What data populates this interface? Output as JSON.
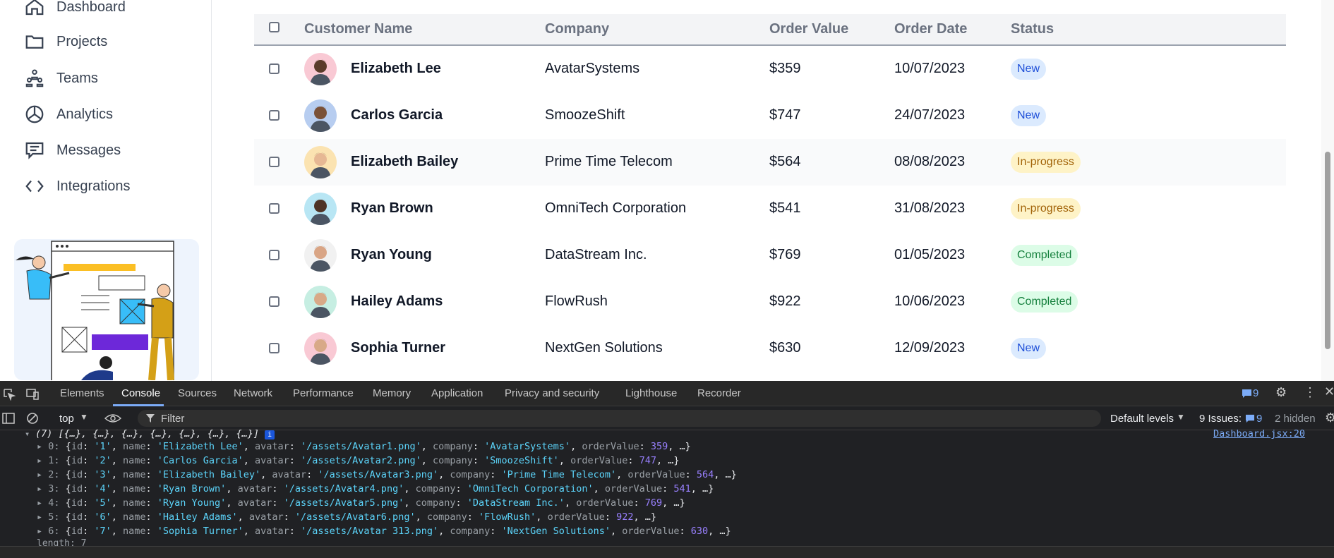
{
  "sidebar": {
    "items": [
      {
        "label": "Dashboard",
        "icon": "home-icon"
      },
      {
        "label": "Projects",
        "icon": "folder-icon"
      },
      {
        "label": "Teams",
        "icon": "teams-icon"
      },
      {
        "label": "Analytics",
        "icon": "pie-chart-icon"
      },
      {
        "label": "Messages",
        "icon": "message-icon"
      },
      {
        "label": "Integrations",
        "icon": "code-icon"
      }
    ]
  },
  "table": {
    "headers": {
      "customer": "Customer Name",
      "company": "Company",
      "order_value": "Order Value",
      "order_date": "Order Date",
      "status": "Status"
    },
    "rows": [
      {
        "name": "Elizabeth Lee",
        "company": "AvatarSystems",
        "value": "$359",
        "date": "10/07/2023",
        "status": "New",
        "status_kind": "new",
        "avatar_bg": "#f9c9d4",
        "skin": "#5a3b2a"
      },
      {
        "name": "Carlos Garcia",
        "company": "SmoozeShift",
        "value": "$747",
        "date": "24/07/2023",
        "status": "New",
        "status_kind": "new",
        "avatar_bg": "#b7cdf0",
        "skin": "#7a5138"
      },
      {
        "name": "Elizabeth Bailey",
        "company": "Prime Time Telecom",
        "value": "$564",
        "date": "08/08/2023",
        "status": "In-progress",
        "status_kind": "inprogress",
        "avatar_bg": "#fbe3b1",
        "skin": "#e6b894"
      },
      {
        "name": "Ryan Brown",
        "company": "OmniTech Corporation",
        "value": "$541",
        "date": "31/08/2023",
        "status": "In-progress",
        "status_kind": "inprogress",
        "avatar_bg": "#b8e6f4",
        "skin": "#4e3325"
      },
      {
        "name": "Ryan Young",
        "company": "DataStream Inc.",
        "value": "$769",
        "date": "01/05/2023",
        "status": "Completed",
        "status_kind": "completed",
        "avatar_bg": "#f1f1f1",
        "skin": "#d9a585"
      },
      {
        "name": "Hailey Adams",
        "company": "FlowRush",
        "value": "$922",
        "date": "10/06/2023",
        "status": "Completed",
        "status_kind": "completed",
        "avatar_bg": "#c6eee2",
        "skin": "#d8a987"
      },
      {
        "name": "Sophia Turner",
        "company": "NextGen Solutions",
        "value": "$630",
        "date": "12/09/2023",
        "status": "New",
        "status_kind": "new",
        "avatar_bg": "#f9c9d4",
        "skin": "#d8a987"
      }
    ]
  },
  "devtools": {
    "tabs": [
      "Elements",
      "Console",
      "Sources",
      "Network",
      "Performance",
      "Memory",
      "Application",
      "Privacy and security",
      "Lighthouse",
      "Recorder"
    ],
    "active_tab": "Console",
    "message_count": "9",
    "context": "top",
    "filter_placeholder": "Filter",
    "levels": "Default levels",
    "issues_label": "9 Issues:",
    "issues_count": "9",
    "hidden": "2 hidden",
    "source_link": "Dashboard.jsx:20",
    "array_summary": "(7) [{…}, {…}, {…}, {…}, {…}, {…}, {…}]",
    "entries": [
      {
        "idx": "0",
        "id": "'1'",
        "name": "'Elizabeth Lee'",
        "avatar": "'/assets/Avatar1.png'",
        "company": "'AvatarSystems'",
        "orderValue": "359"
      },
      {
        "idx": "1",
        "id": "'2'",
        "name": "'Carlos Garcia'",
        "avatar": "'/assets/Avatar2.png'",
        "company": "'SmoozeShift'",
        "orderValue": "747"
      },
      {
        "idx": "2",
        "id": "'3'",
        "name": "'Elizabeth Bailey'",
        "avatar": "'/assets/Avatar3.png'",
        "company": "'Prime Time Telecom'",
        "orderValue": "564"
      },
      {
        "idx": "3",
        "id": "'4'",
        "name": "'Ryan Brown'",
        "avatar": "'/assets/Avatar4.png'",
        "company": "'OmniTech Corporation'",
        "orderValue": "541"
      },
      {
        "idx": "4",
        "id": "'5'",
        "name": "'Ryan Young'",
        "avatar": "'/assets/Avatar5.png'",
        "company": "'DataStream Inc.'",
        "orderValue": "769"
      },
      {
        "idx": "5",
        "id": "'6'",
        "name": "'Hailey Adams'",
        "avatar": "'/assets/Avatar6.png'",
        "company": "'FlowRush'",
        "orderValue": "922"
      },
      {
        "idx": "6",
        "id": "'7'",
        "name": "'Sophia Turner'",
        "avatar": "'/assets/Avatar 313.png'",
        "company": "'NextGen Solutions'",
        "orderValue": "630"
      }
    ],
    "length_line": "length: 7"
  }
}
